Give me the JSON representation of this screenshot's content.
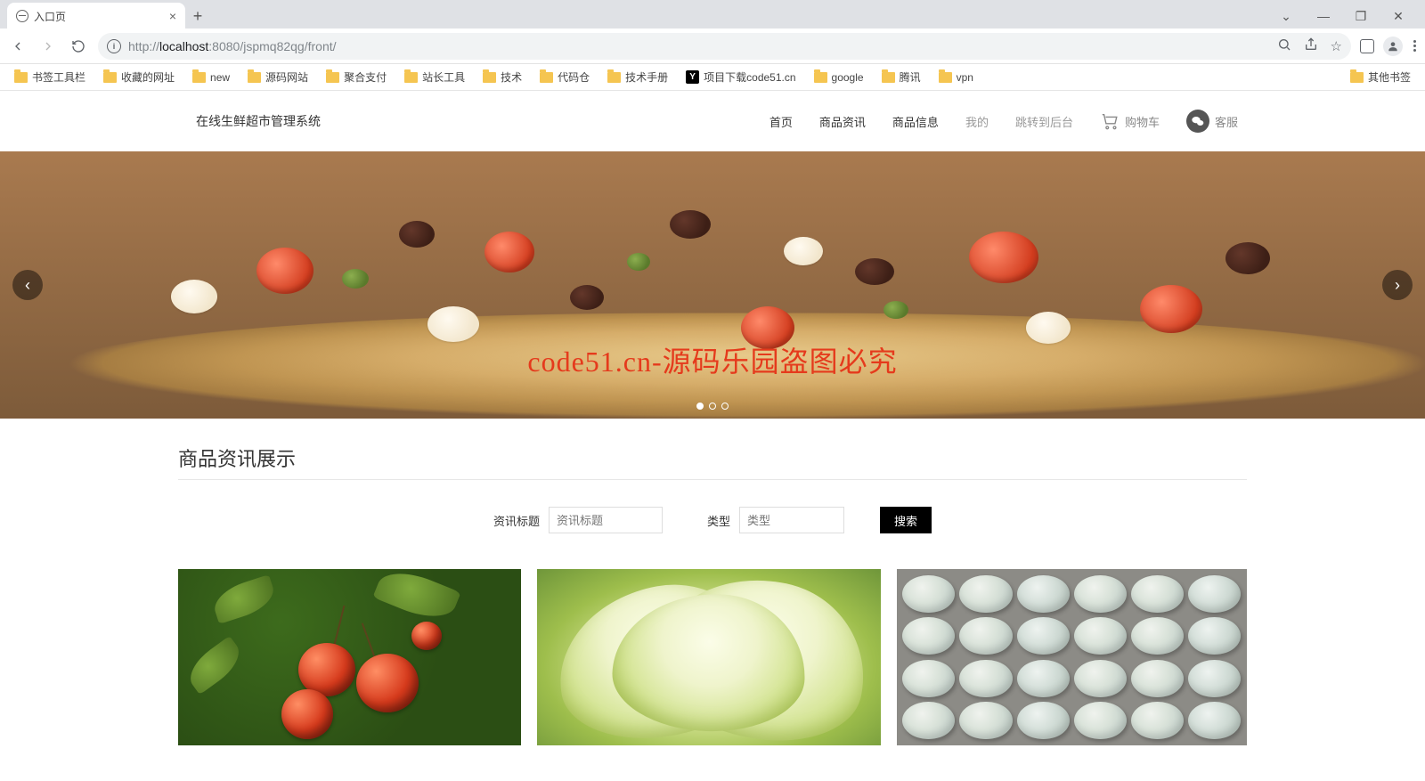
{
  "browser": {
    "tab_title": "入口页",
    "url_host": "localhost",
    "url_port": ":8080",
    "url_path": "/jspmq82qg/front/",
    "url_scheme": "http://"
  },
  "bookmarks_left": [
    {
      "label": "书签工具栏",
      "kind": "folder"
    },
    {
      "label": "收藏的网址",
      "kind": "folder"
    },
    {
      "label": "new",
      "kind": "folder"
    },
    {
      "label": "源码网站",
      "kind": "folder"
    },
    {
      "label": "聚合支付",
      "kind": "folder"
    },
    {
      "label": "站长工具",
      "kind": "folder"
    },
    {
      "label": "技术",
      "kind": "folder"
    },
    {
      "label": "代码仓",
      "kind": "folder"
    },
    {
      "label": "技术手册",
      "kind": "folder"
    },
    {
      "label": "项目下载code51.cn",
      "kind": "y"
    },
    {
      "label": "google",
      "kind": "folder"
    },
    {
      "label": "腾讯",
      "kind": "folder"
    },
    {
      "label": "vpn",
      "kind": "folder"
    }
  ],
  "bookmarks_right": {
    "label": "其他书签"
  },
  "site": {
    "brand": "在线生鲜超市管理系统",
    "nav": [
      {
        "label": "首页",
        "muted": false
      },
      {
        "label": "商品资讯",
        "muted": false
      },
      {
        "label": "商品信息",
        "muted": false
      },
      {
        "label": "我的",
        "muted": true
      },
      {
        "label": "跳转到后台",
        "muted": true
      }
    ],
    "cart_label": "购物车",
    "service_label": "客服"
  },
  "carousel": {
    "watermark": "code51.cn-源码乐园盗图必究",
    "dots_total": 3,
    "active_dot": 0
  },
  "section": {
    "title": "商品资讯展示",
    "search": {
      "title_label": "资讯标题",
      "title_placeholder": "资讯标题",
      "type_label": "类型",
      "type_placeholder": "类型",
      "button": "搜索"
    }
  }
}
